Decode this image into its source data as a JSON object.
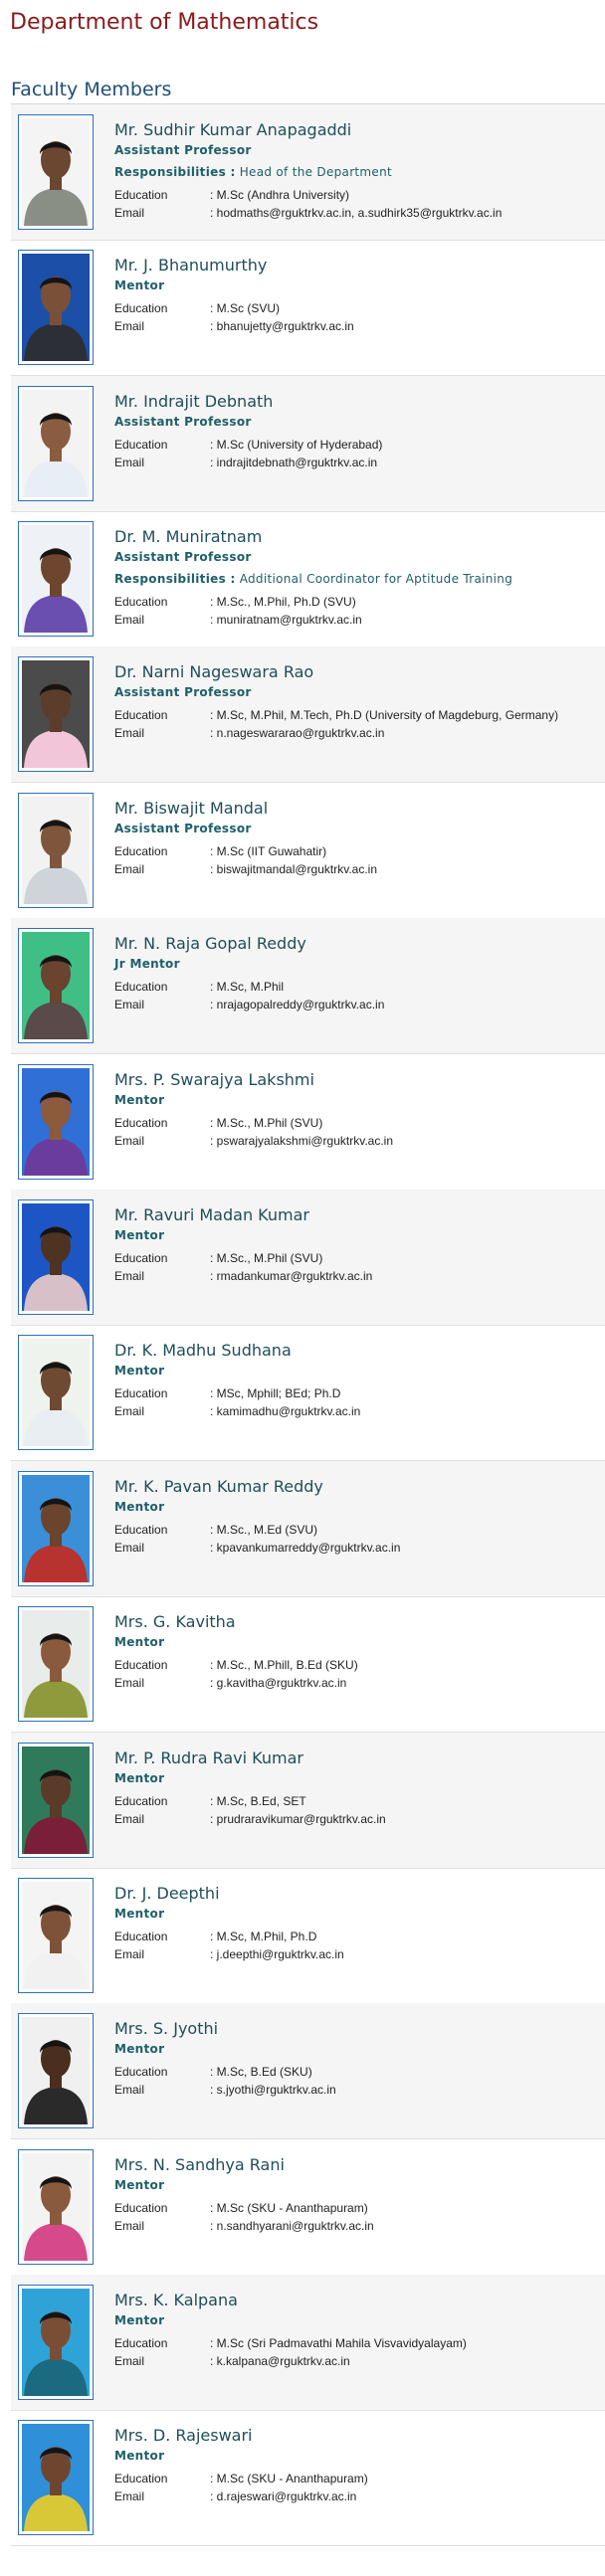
{
  "page": {
    "department_title": "Department of Mathematics",
    "section_title": "Faculty Members",
    "education_label": "Education",
    "email_label": "Email",
    "responsibilities_label": "Responsibilities :"
  },
  "theme": {
    "heading_color": "#8b1a1a",
    "section_color": "#1f4e79",
    "name_color": "#1f4e5a",
    "photo_border": "#2f6fbd",
    "alt_row_background": "#f5f5f5"
  },
  "faculty": [
    {
      "name": "Mr. Sudhir Kumar Anapagaddi",
      "role": "Assistant Professor",
      "responsibility": "Head of the Department",
      "education": ": M.Sc (Andhra University)",
      "email": ": hodmaths@rguktrkv.ac.in, a.sudhirk35@rguktrkv.ac.in",
      "shirt": "#8a8f86",
      "skin": "#6b4630",
      "bg": "#f4f4f4"
    },
    {
      "name": "Mr. J. Bhanumurthy",
      "role": "Mentor",
      "responsibility": "",
      "education": ": M.Sc (SVU)",
      "email": ": bhanujetty@rguktrkv.ac.in",
      "shirt": "#2d2f36",
      "skin": "#7a5038",
      "bg": "#1b4fa8"
    },
    {
      "name": "Mr. Indrajit Debnath",
      "role": "Assistant Professor",
      "responsibility": "",
      "education": ": M.Sc (University of Hyderabad)",
      "email": ": indrajitdebnath@rguktrkv.ac.in",
      "shirt": "#e8eef5",
      "skin": "#8a5c40",
      "bg": "#f3f3f3"
    },
    {
      "name": "Dr. M. Muniratnam",
      "role": "Assistant Professor",
      "responsibility": "Additional Coordinator for Aptitude Training",
      "education": ": M.Sc., M.Phil, Ph.D (SVU)",
      "email": ": muniratnam@rguktrkv.ac.in",
      "shirt": "#6a4fb0",
      "skin": "#6e4630",
      "bg": "#eef2f7"
    },
    {
      "name": "Dr. Narni Nageswara Rao",
      "role": "Assistant Professor",
      "responsibility": "",
      "education": ": M.Sc, M.Phil, M.Tech, Ph.D (University of Magdeburg, Germany)",
      "email": ": n.nageswararao@rguktrkv.ac.in",
      "shirt": "#f2c6d8",
      "skin": "#5c3c2a",
      "bg": "#4b4b4b"
    },
    {
      "name": "Mr. Biswajit Mandal",
      "role": "Assistant Professor",
      "responsibility": "",
      "education": ": M.Sc (IIT Guwahatir)",
      "email": ": biswajitmandal@rguktrkv.ac.in",
      "shirt": "#cfd3da",
      "skin": "#7e563c",
      "bg": "#f2f2f2"
    },
    {
      "name": "Mr. N. Raja Gopal Reddy",
      "role": "Jr Mentor",
      "responsibility": "",
      "education": ": M.Sc, M.Phil",
      "email": ": nrajagopalreddy@rguktrkv.ac.in",
      "shirt": "#5a4a4a",
      "skin": "#6a442e",
      "bg": "#3fbf86"
    },
    {
      "name": "Mrs. P. Swarajya Lakshmi",
      "role": "Mentor",
      "responsibility": "",
      "education": ": M.Sc., M.Phil (SVU)",
      "email": ": pswarajyalakshmi@rguktrkv.ac.in",
      "shirt": "#6a3c9c",
      "skin": "#8c5a3c",
      "bg": "#2f6fd6"
    },
    {
      "name": "Mr. Ravuri Madan Kumar",
      "role": "Mentor",
      "responsibility": "",
      "education": ": M.Sc., M.Phil (SVU)",
      "email": ": rmadankumar@rguktrkv.ac.in",
      "shirt": "#d7c0c8",
      "skin": "#4e3222",
      "bg": "#1d56c4"
    },
    {
      "name": "Dr. K. Madhu Sudhana",
      "role": "Mentor",
      "responsibility": "",
      "education": ": MSc, Mphill; BEd; Ph.D",
      "email": ": kamimadhu@rguktrkv.ac.in",
      "shirt": "#e9eef2",
      "skin": "#6f4a33",
      "bg": "#eef3ee"
    },
    {
      "name": "Mr. K. Pavan Kumar Reddy",
      "role": "Mentor",
      "responsibility": "",
      "education": ": M.Sc., M.Ed (SVU)",
      "email": ": kpavankumarreddy@rguktrkv.ac.in",
      "shirt": "#b8322f",
      "skin": "#6a442c",
      "bg": "#3a8fd8"
    },
    {
      "name": "Mrs. G. Kavitha",
      "role": "Mentor",
      "responsibility": "",
      "education": ": M.Sc., M.Phill, B.Ed (SKU)",
      "email": ": g.kavitha@rguktrkv.ac.in",
      "shirt": "#8e9a3c",
      "skin": "#8a5a3c",
      "bg": "#e8ecea"
    },
    {
      "name": "Mr. P. Rudra Ravi Kumar",
      "role": "Mentor",
      "responsibility": "",
      "education": ": M.Sc, B.Ed, SET",
      "email": ": prudraravikumar@rguktrkv.ac.in",
      "shirt": "#7a1f3a",
      "skin": "#5a3a28",
      "bg": "#2f7a5a"
    },
    {
      "name": "Dr. J. Deepthi",
      "role": "Mentor",
      "responsibility": "",
      "education": ": M.Sc, M.Phil, Ph.D",
      "email": ": j.deepthi@rguktrkv.ac.in",
      "shirt": "#f1f1f1",
      "skin": "#7e5238",
      "bg": "#f4f4f4"
    },
    {
      "name": "Mrs. S. Jyothi",
      "role": "Mentor",
      "responsibility": "",
      "education": ": M.Sc, B.Ed (SKU)",
      "email": ": s.jyothi@rguktrkv.ac.in",
      "shirt": "#2a2a2a",
      "skin": "#4a2e1e",
      "bg": "#f0f0f0"
    },
    {
      "name": "Mrs. N. Sandhya Rani",
      "role": "Mentor",
      "responsibility": "",
      "education": ": M.Sc (SKU - Ananthapuram)",
      "email": ": n.sandhyarani@rguktrkv.ac.in",
      "shirt": "#d64a8c",
      "skin": "#8a5a3e",
      "bg": "#f3f3f3"
    },
    {
      "name": "Mrs. K. Kalpana",
      "role": "Mentor",
      "responsibility": "",
      "education": ": M.Sc (Sri Padmavathi Mahila Visvavidyalayam)",
      "email": ": k.kalpana@rguktrkv.ac.in",
      "shirt": "#1c6a80",
      "skin": "#7a4e34",
      "bg": "#2fa3d8"
    },
    {
      "name": "Mrs. D. Rajeswari",
      "role": "Mentor",
      "responsibility": "",
      "education": ": M.Sc (SKU - Ananthapuram)",
      "email": ": d.rajeswari@rguktrkv.ac.in",
      "shirt": "#d8c838",
      "skin": "#6e4630",
      "bg": "#2f8fd8"
    }
  ]
}
